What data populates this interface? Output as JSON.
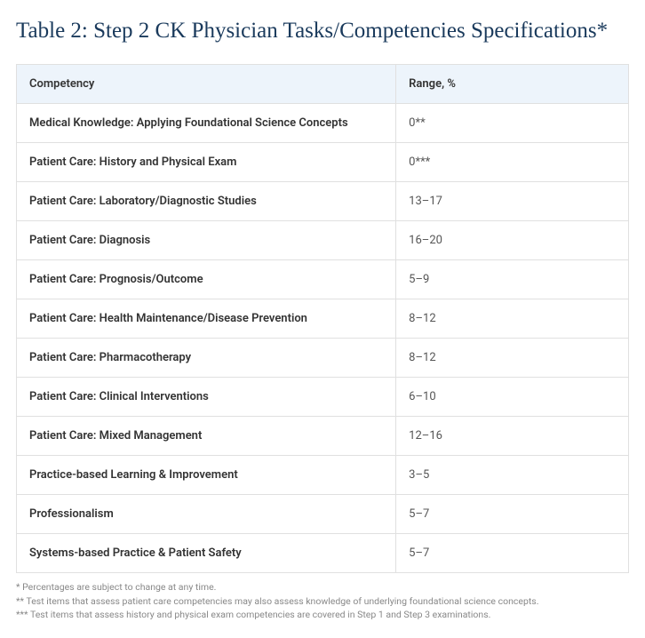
{
  "title": "Table 2: Step 2 CK Physician Tasks/Competencies Specifications*",
  "table": {
    "headers": {
      "competency": "Competency",
      "range": "Range, %"
    },
    "rows": [
      {
        "competency": "Medical Knowledge: Applying Foundational Science Concepts",
        "range": "0**"
      },
      {
        "competency": "Patient Care: History and Physical Exam",
        "range": "0***"
      },
      {
        "competency": "Patient Care: Laboratory/Diagnostic Studies",
        "range": "13–17"
      },
      {
        "competency": "Patient Care: Diagnosis",
        "range": "16–20"
      },
      {
        "competency": "Patient Care: Prognosis/Outcome",
        "range": "5–9"
      },
      {
        "competency": "Patient Care: Health Maintenance/Disease Prevention",
        "range": "8–12"
      },
      {
        "competency": "Patient Care: Pharmacotherapy",
        "range": "8–12"
      },
      {
        "competency": "Patient Care: Clinical Interventions",
        "range": "6–10"
      },
      {
        "competency": "Patient Care: Mixed Management",
        "range": "12–16"
      },
      {
        "competency": "Practice-based Learning & Improvement",
        "range": "3–5"
      },
      {
        "competency": "Professionalism",
        "range": "5–7"
      },
      {
        "competency": "Systems-based Practice & Patient Safety",
        "range": "5–7"
      }
    ]
  },
  "footnotes": [
    "* Percentages are subject to change at any time.",
    "** Test items that assess patient care competencies may also assess knowledge of underlying foundational science concepts.",
    "*** Test items that assess history and physical exam competencies are covered in Step 1 and Step 3 examinations."
  ]
}
